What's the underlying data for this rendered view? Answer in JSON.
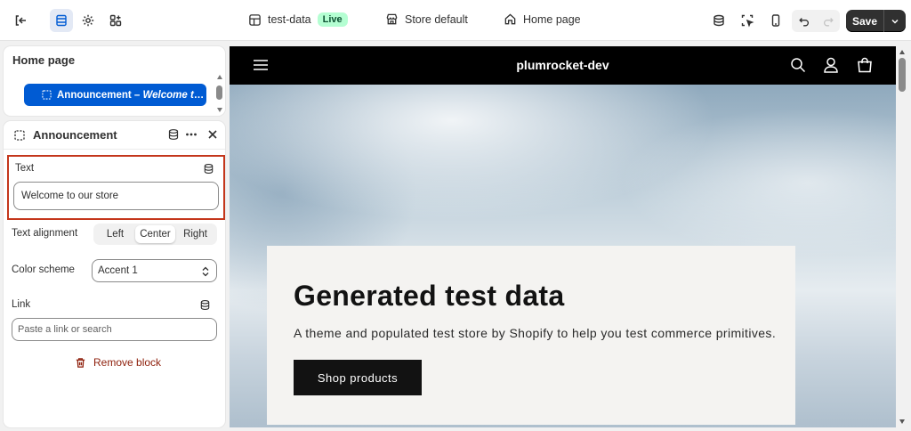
{
  "topbar": {
    "theme_name": "test-data",
    "theme_status": "Live",
    "store_context": "Store default",
    "page": "Home page",
    "save_label": "Save",
    "icons": [
      "exit-icon",
      "sections-icon",
      "settings-gear-icon",
      "apps-icon",
      "inspector-icon",
      "select-element-icon",
      "mobile-preview-icon",
      "undo-icon",
      "redo-icon"
    ]
  },
  "sidebar": {
    "title": "Home page",
    "selected_item": {
      "prefix": "Announcement – ",
      "title": "Welcome to o..."
    }
  },
  "block": {
    "title": "Announcement",
    "text_label": "Text",
    "text_value": "Welcome to our store",
    "alignment_label": "Text alignment",
    "alignment_options": [
      "Left",
      "Center",
      "Right"
    ],
    "alignment_selected": "Center",
    "color_scheme_label": "Color scheme",
    "color_scheme_value": "Accent 1",
    "link_label": "Link",
    "link_placeholder": "Paste a link or search",
    "remove_label": "Remove block"
  },
  "preview": {
    "store_name": "plumrocket-dev",
    "hero_title": "Generated test data",
    "hero_text": "A theme and populated test store by Shopify to help you test commerce primitives.",
    "hero_button": "Shop products"
  },
  "colors": {
    "accent_blue": "#005bd3",
    "live_badge_bg": "#b4fed2",
    "highlight_border": "#c4361b",
    "danger_text": "#8e1f0b",
    "save_bg": "#303030"
  }
}
